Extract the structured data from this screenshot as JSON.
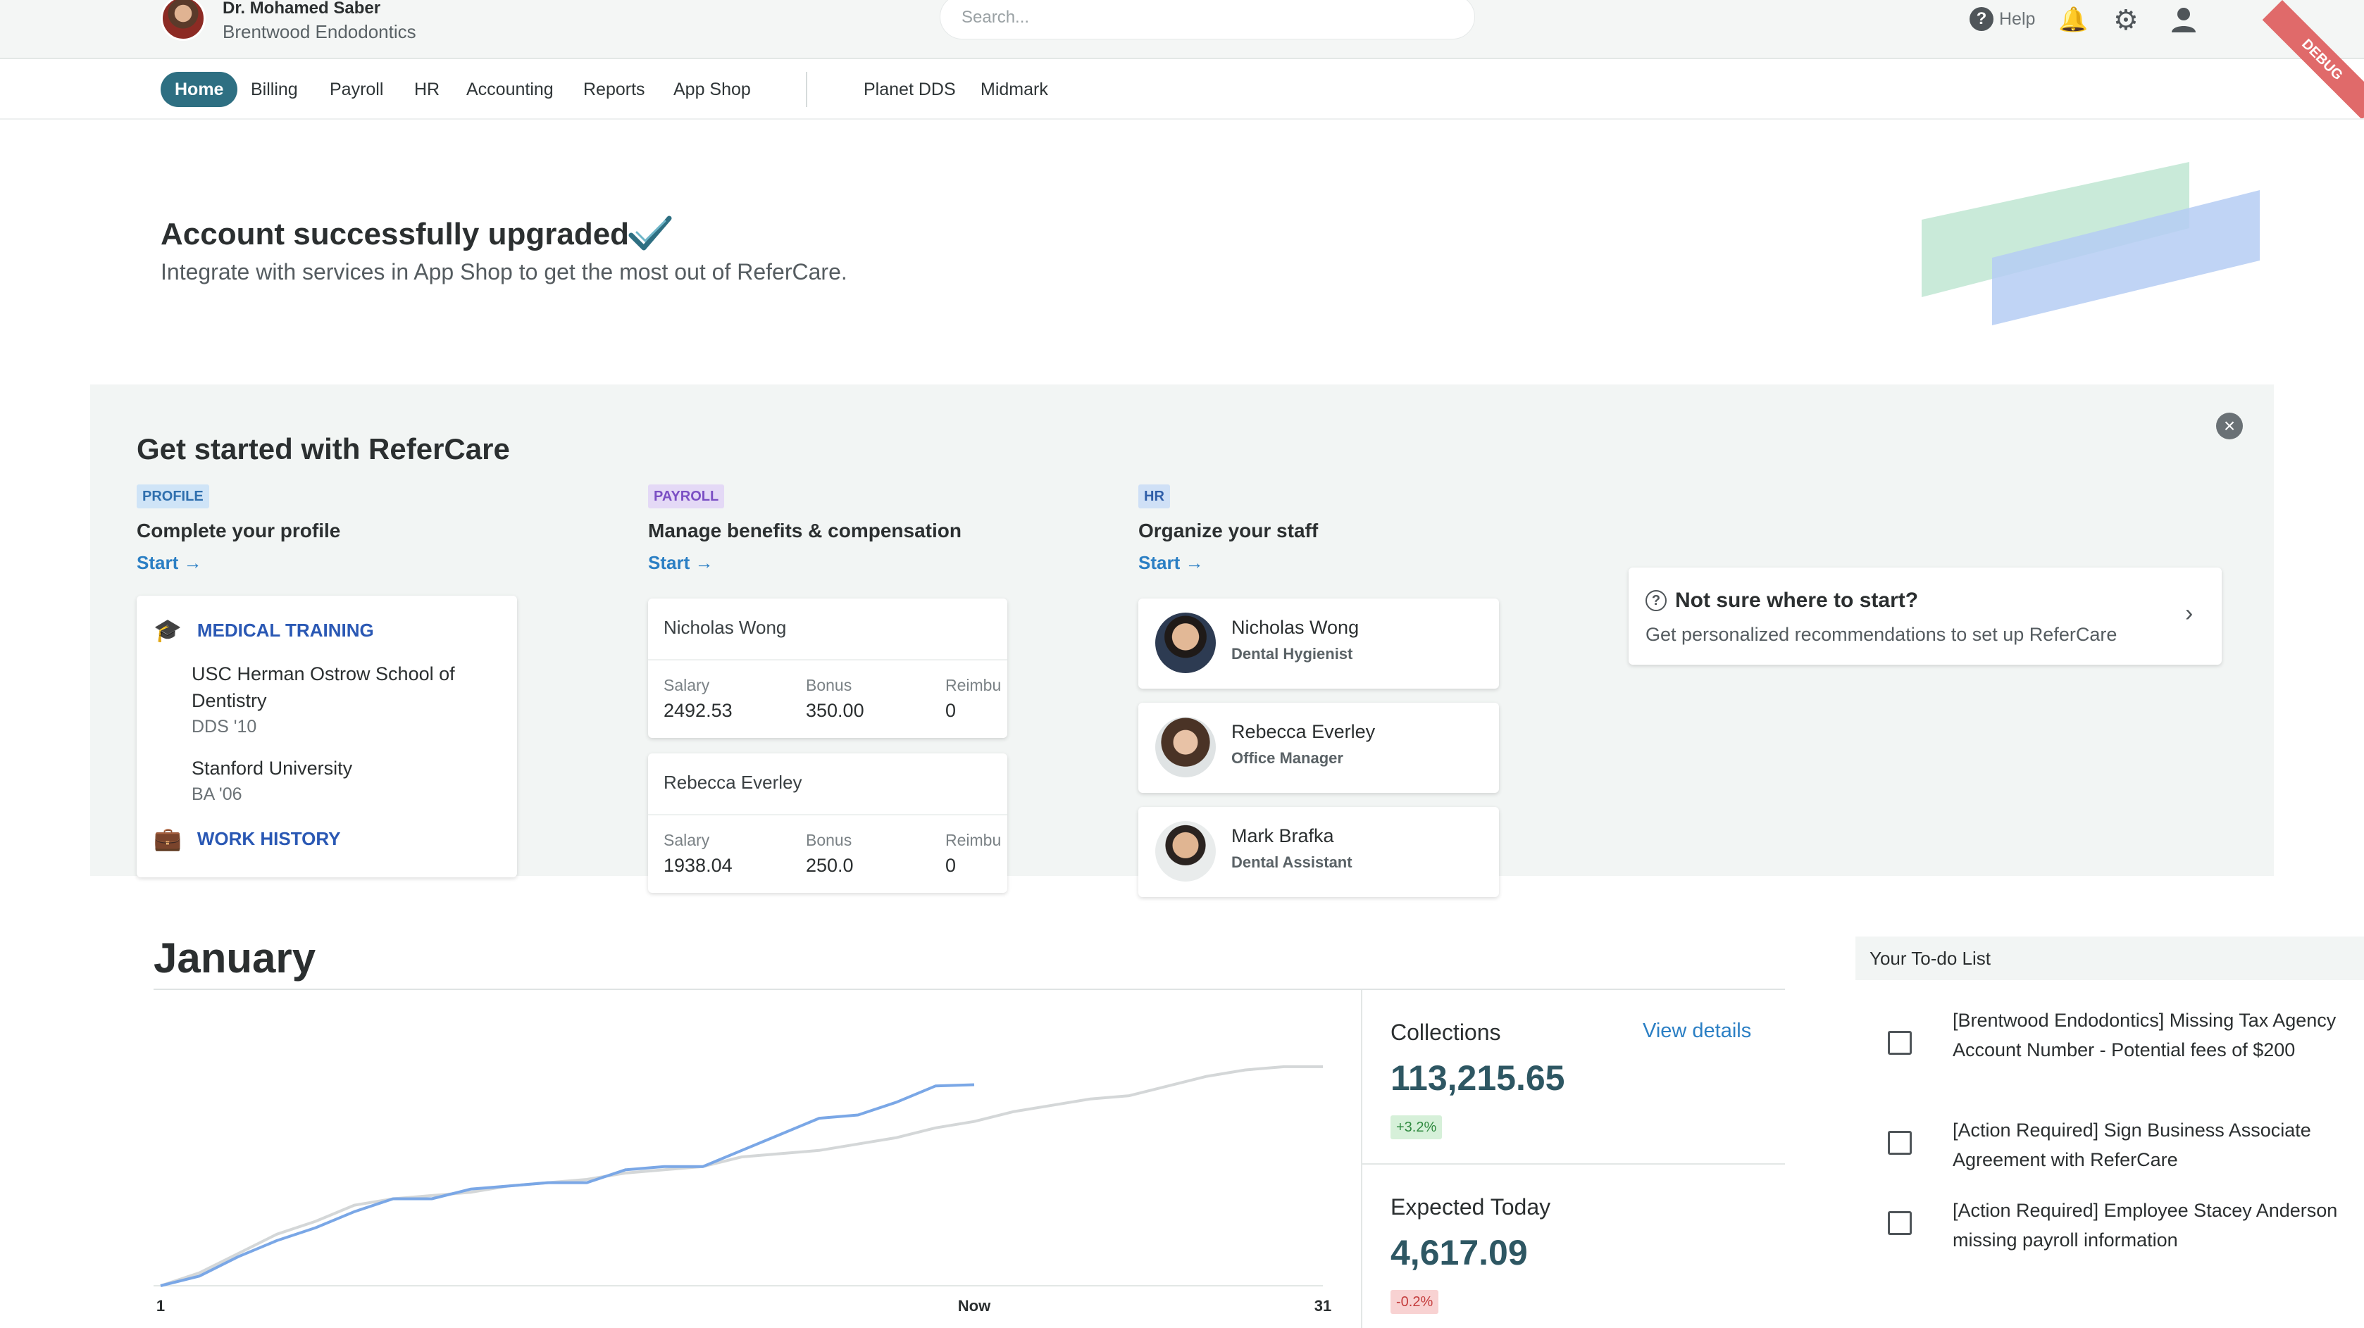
{
  "header": {
    "user_name": "Dr. Mohamed Saber",
    "org_name": "Brentwood Endodontics",
    "search_placeholder": "Search...",
    "help_label": "Help",
    "debug_label": "DEBUG"
  },
  "nav": {
    "items": [
      "Home",
      "Billing",
      "Payroll",
      "HR",
      "Accounting",
      "Reports",
      "App Shop"
    ],
    "active": "Home",
    "integrations": [
      "Planet DDS",
      "Midmark"
    ]
  },
  "banner": {
    "title": "Account successfully upgraded",
    "subtitle": "Integrate with services in App Shop to get the most out of ReferCare."
  },
  "get_started": {
    "title": "Get started with ReferCare",
    "columns": [
      {
        "tag": "PROFILE",
        "title": "Complete your profile",
        "link": "Start →"
      },
      {
        "tag": "PAYROLL",
        "title": "Manage benefits & compensation",
        "link": "Start →"
      },
      {
        "tag": "HR",
        "title": "Organize your staff",
        "link": "Start →"
      }
    ],
    "profile_card": {
      "section1": "MEDICAL TRAINING",
      "education": [
        {
          "school": "USC Herman Ostrow School of Dentistry",
          "degree": "DDS '10"
        },
        {
          "school": "Stanford University",
          "degree": "BA '06"
        }
      ],
      "section2": "WORK HISTORY"
    },
    "payroll_cards": [
      {
        "name": "Nicholas Wong",
        "salary_label": "Salary",
        "salary": "2492.53",
        "bonus_label": "Bonus",
        "bonus": "350.00",
        "reimb_label": "Reimbu",
        "reimb": "0"
      },
      {
        "name": "Rebecca Everley",
        "salary_label": "Salary",
        "salary": "1938.04",
        "bonus_label": "Bonus",
        "bonus": "250.0",
        "reimb_label": "Reimbu",
        "reimb": "0"
      }
    ],
    "staff": [
      {
        "name": "Nicholas Wong",
        "role": "Dental Hygienist"
      },
      {
        "name": "Rebecca Everley",
        "role": "Office Manager"
      },
      {
        "name": "Mark Brafka",
        "role": "Dental Assistant"
      }
    ],
    "recommend": {
      "title": "Not sure where to start?",
      "subtitle": "Get personalized recommendations to set up ReferCare"
    }
  },
  "month": {
    "title": "January",
    "collections_label": "Collections",
    "collections_value": "113,215.65",
    "collections_change": "+3.2%",
    "view_details": "View details",
    "expected_label": "Expected Today",
    "expected_value": "4,617.09",
    "expected_change": "-0.2%"
  },
  "chart_data": {
    "type": "line",
    "x_ticks": [
      "1",
      "Now",
      "31"
    ],
    "xlim": [
      1,
      31
    ],
    "series": [
      {
        "color": "#7aa7e6",
        "x": [
          1,
          2,
          3,
          4,
          5,
          6,
          7,
          8,
          9,
          10,
          11,
          12,
          13,
          14,
          15,
          16,
          17,
          18,
          19,
          20,
          21,
          22
        ],
        "values": [
          0,
          1.5,
          4.5,
          7,
          9,
          11.5,
          13.5,
          13.5,
          15,
          15.5,
          16,
          16,
          18,
          18.5,
          18.5,
          21,
          23.5,
          26,
          26.5,
          28.5,
          31,
          31.2
        ]
      },
      {
        "color": "#d4d7d8",
        "x": [
          1,
          2,
          3,
          4,
          5,
          6,
          7,
          8,
          9,
          10,
          11,
          12,
          13,
          14,
          15,
          16,
          17,
          18,
          19,
          20,
          21,
          22,
          23,
          24,
          25,
          26,
          27,
          28,
          29,
          30,
          31
        ],
        "values": [
          0,
          2,
          5,
          8,
          10,
          12.5,
          13.5,
          14,
          14.5,
          15.5,
          16,
          16.5,
          17.5,
          18,
          18.5,
          20,
          20.5,
          21,
          22,
          23,
          24.5,
          25.5,
          27,
          28,
          29,
          29.5,
          31,
          32.5,
          33.5,
          34,
          34
        ]
      }
    ],
    "grid": false
  },
  "todo": {
    "title": "Your To-do List",
    "items": [
      "[Brentwood Endodontics] Missing Tax Agency Account Number - Potential fees of $200",
      "[Action Required] Sign Business Associate Agreement with ReferCare",
      "[Action Required] Employee Stacey Anderson missing payroll information"
    ]
  },
  "colors": {
    "primary": "#2e6f82",
    "link": "#2b7fc4",
    "chart_current": "#7aa7e6",
    "chart_previous": "#d4d7d8"
  }
}
